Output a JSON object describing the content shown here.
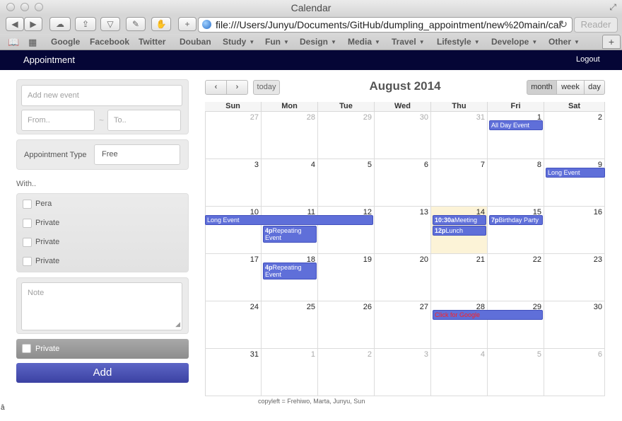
{
  "window": {
    "title": "Calendar"
  },
  "browser": {
    "url": "file:///Users/Junyu/Documents/GitHub/dumpling_appointment/new%20main/cal",
    "reader_label": "Reader",
    "bookmarks": [
      {
        "label": "Google",
        "menu": false
      },
      {
        "label": "Facebook",
        "menu": false
      },
      {
        "label": "Twitter",
        "menu": false
      },
      {
        "label": "Douban",
        "menu": false
      },
      {
        "label": "Study",
        "menu": true
      },
      {
        "label": "Fun",
        "menu": true
      },
      {
        "label": "Design",
        "menu": true
      },
      {
        "label": "Media",
        "menu": true
      },
      {
        "label": "Travel",
        "menu": true
      },
      {
        "label": "Lifestyle",
        "menu": true
      },
      {
        "label": "Develope",
        "menu": true
      },
      {
        "label": "Other",
        "menu": true
      }
    ]
  },
  "nav": {
    "brand": "Appointment",
    "logout": "Logout"
  },
  "form": {
    "new_event_placeholder": "Add new event",
    "from_placeholder": "From..",
    "separator": "~",
    "to_placeholder": "To..",
    "type_label": "Appointment Type",
    "type_value": "Free",
    "with_label": "With..",
    "participants": [
      "Pera",
      "Private",
      "Private",
      "Private"
    ],
    "note_placeholder": "Note",
    "private_label": "Private",
    "add_label": "Add",
    "stray_char": "â"
  },
  "calendar": {
    "prev_icon": "‹",
    "next_icon": "›",
    "today_label": "today",
    "title": "August 2014",
    "views": [
      "month",
      "week",
      "day"
    ],
    "active_view": "month",
    "weekdays": [
      "Sun",
      "Mon",
      "Tue",
      "Wed",
      "Thu",
      "Fri",
      "Sat"
    ],
    "weeks": [
      [
        27,
        28,
        29,
        30,
        31,
        1,
        2
      ],
      [
        3,
        4,
        5,
        6,
        7,
        8,
        9
      ],
      [
        10,
        11,
        12,
        13,
        14,
        15,
        16
      ],
      [
        17,
        18,
        19,
        20,
        21,
        22,
        23
      ],
      [
        24,
        25,
        26,
        27,
        28,
        29,
        30
      ],
      [
        31,
        1,
        2,
        3,
        4,
        5,
        6
      ]
    ],
    "today": 14,
    "events": [
      {
        "title": "All Day Event",
        "time": "",
        "week": 0,
        "start": 5,
        "span": 1,
        "slot": 0,
        "wrap": false,
        "link": false
      },
      {
        "title": "Long Event",
        "time": "",
        "week": 1,
        "start": 6,
        "span": 1,
        "slot": 0,
        "wrap": false,
        "link": false
      },
      {
        "title": "Long Event",
        "time": "",
        "week": 2,
        "start": 0,
        "span": 3,
        "slot": 0,
        "wrap": false,
        "link": false
      },
      {
        "title": "Meeting",
        "time": "10:30a",
        "week": 2,
        "start": 4,
        "span": 1,
        "slot": 0,
        "wrap": false,
        "link": false
      },
      {
        "title": "Birthday Party",
        "time": "7p",
        "week": 2,
        "start": 5,
        "span": 1,
        "slot": 0,
        "wrap": false,
        "link": false
      },
      {
        "title": "Lunch",
        "time": "12p",
        "week": 2,
        "start": 4,
        "span": 1,
        "slot": 1,
        "wrap": false,
        "link": false
      },
      {
        "title": "Repeating Event",
        "time": "4p",
        "week": 2,
        "start": 1,
        "span": 1,
        "slot": 1,
        "wrap": true,
        "link": false
      },
      {
        "title": "Repeating Event",
        "time": "4p",
        "week": 3,
        "start": 1,
        "span": 1,
        "slot": 0,
        "wrap": true,
        "link": false
      },
      {
        "title": "Click for Google",
        "time": "",
        "week": 4,
        "start": 4,
        "span": 2,
        "slot": 0,
        "wrap": false,
        "link": true
      }
    ]
  },
  "footer": "copyleft = Frehiwo, Marta, Junyu, Sun",
  "colors": {
    "nav_bg": "#050636",
    "event_bg": "#5f6fd9",
    "today_bg": "#fcf3d7",
    "add_button": "#3b41a2",
    "link_text": "#ff2020"
  }
}
